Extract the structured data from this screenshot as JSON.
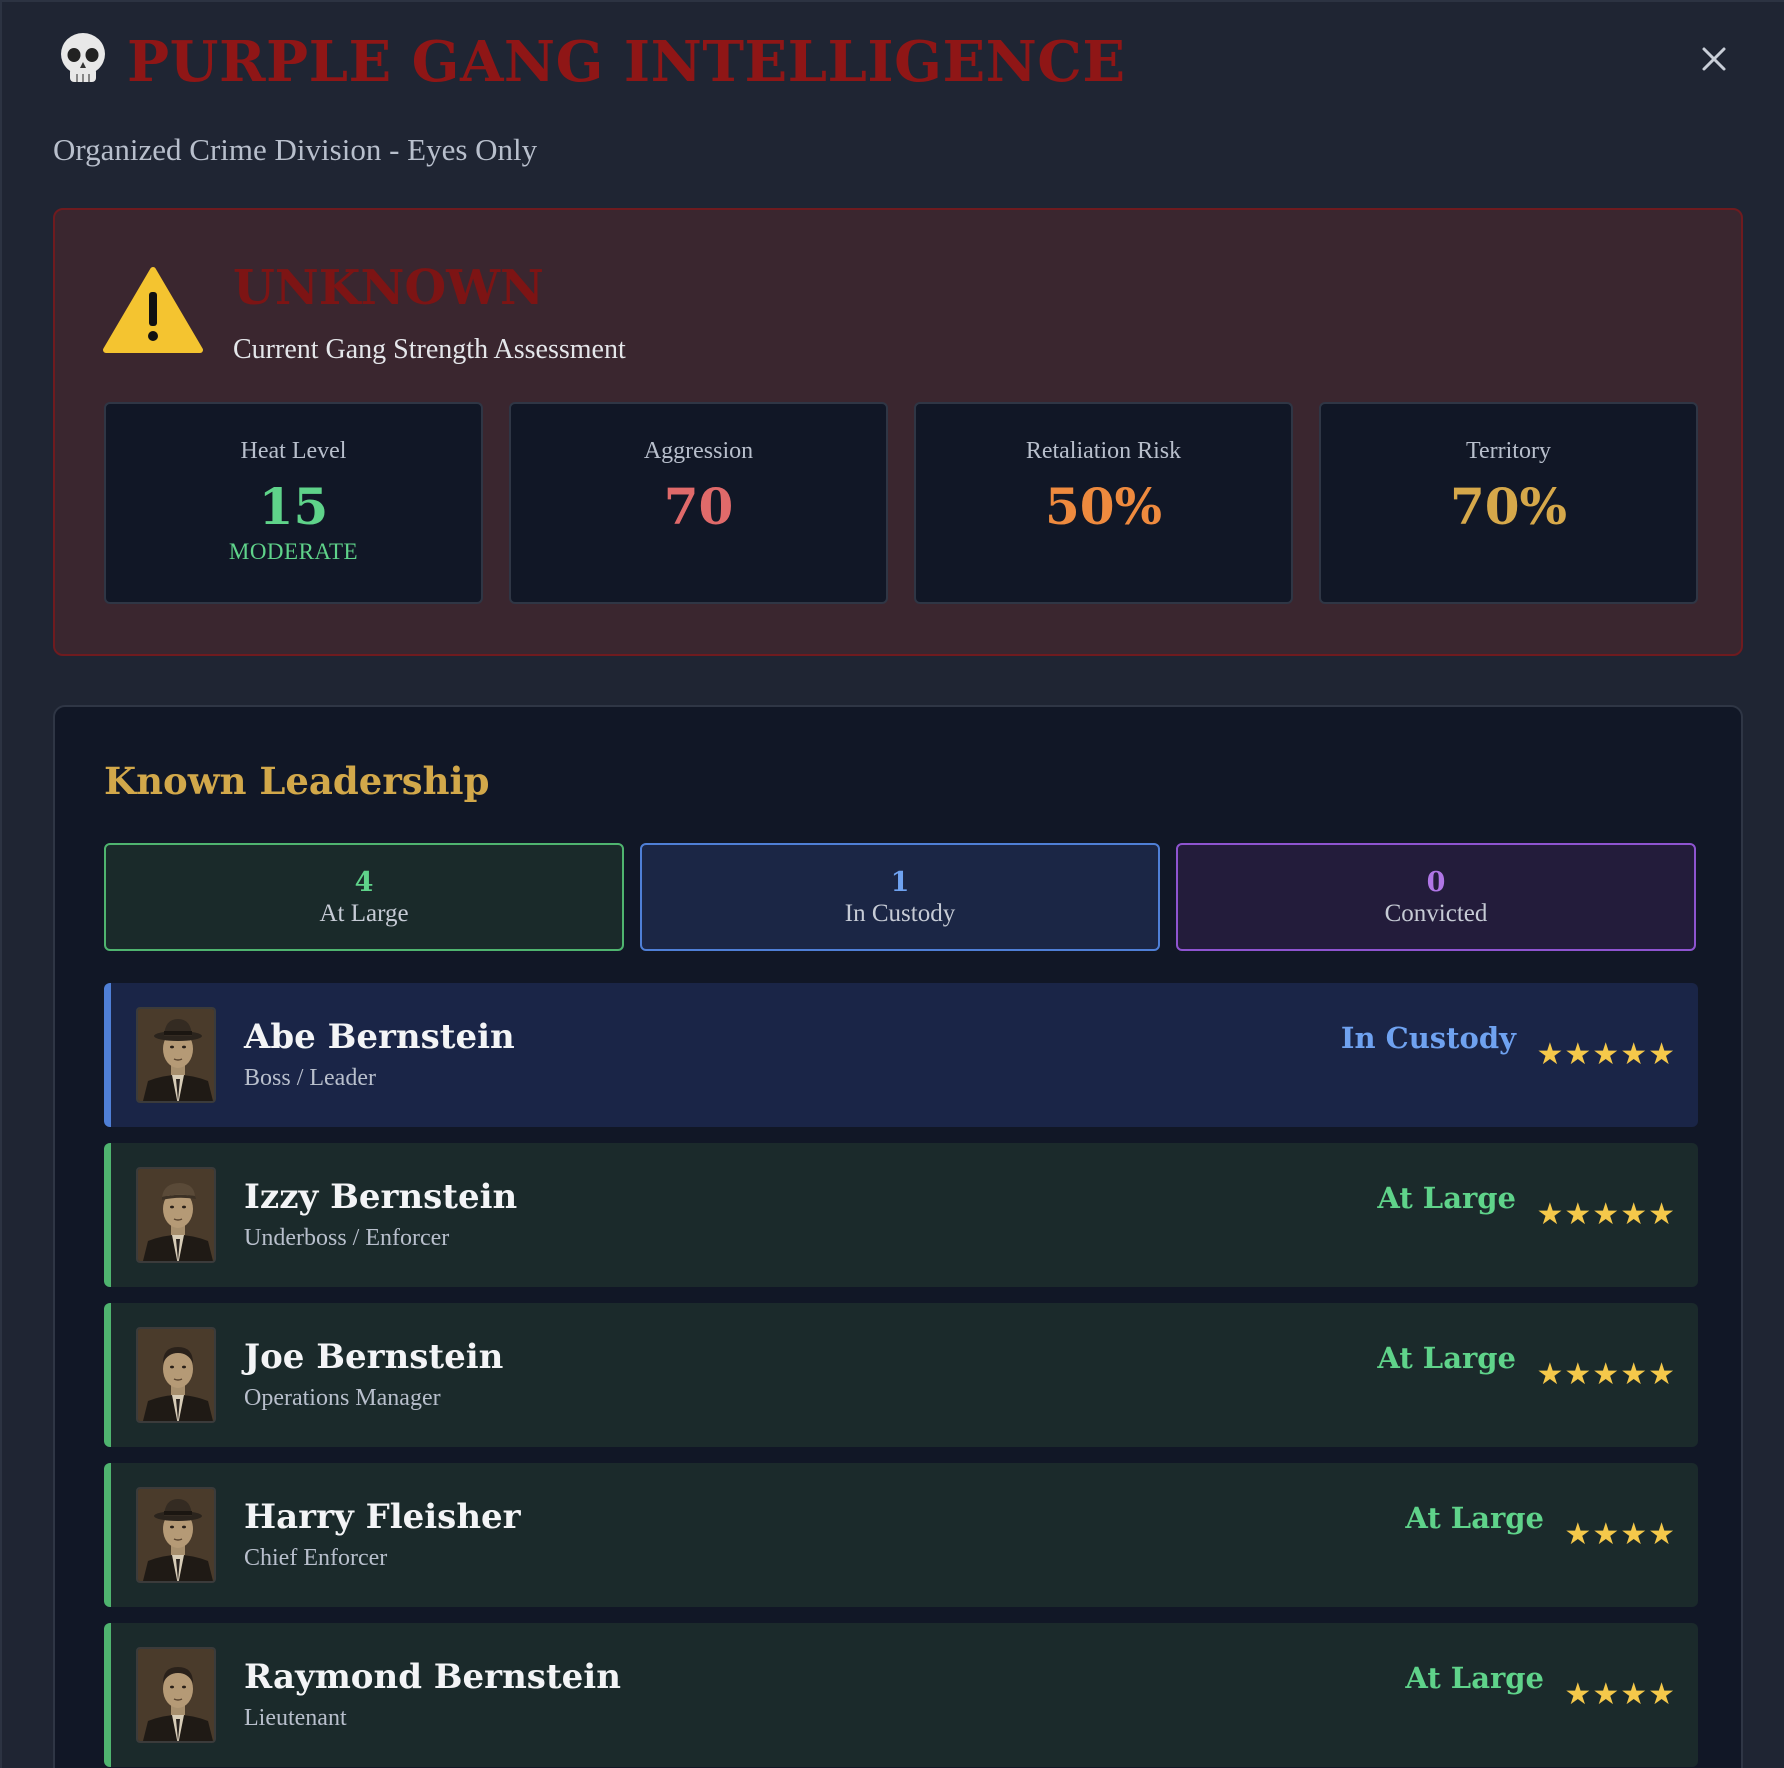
{
  "header": {
    "title": "PURPLE GANG INTELLIGENCE",
    "subtitle": "Organized Crime Division - Eyes Only",
    "close_symbol": "✕"
  },
  "threat": {
    "level": "UNKNOWN",
    "description": "Current Gang Strength Assessment",
    "stats": [
      {
        "label": "Heat Level",
        "value": "15",
        "note": "MODERATE",
        "color": "#5fd38a"
      },
      {
        "label": "Aggression",
        "value": "70",
        "note": "",
        "color": "#e06a6a"
      },
      {
        "label": "Retaliation Risk",
        "value": "50%",
        "note": "",
        "color": "#ee8a3e"
      },
      {
        "label": "Territory",
        "value": "70%",
        "note": "",
        "color": "#d6a84a"
      }
    ]
  },
  "leadership": {
    "title": "Known Leadership",
    "tallies": [
      {
        "count": "4",
        "label": "At Large",
        "color": "#5fd38a",
        "bg": "#1a2a2a",
        "border": "#4fb46f"
      },
      {
        "count": "1",
        "label": "In Custody",
        "color": "#6fa2f0",
        "bg": "#1b2645",
        "border": "#4f7fd6"
      },
      {
        "count": "0",
        "label": "Convicted",
        "color": "#b076e6",
        "bg": "#231c3b",
        "border": "#8e54d0"
      }
    ],
    "members": [
      {
        "name": "Abe Bernstein",
        "role": "Boss / Leader",
        "status": "In Custody",
        "status_color": "#6fa2f0",
        "bg": "#1a2547",
        "accent": "#4f7fd6",
        "stars": "★★★★★",
        "hat": "fedora"
      },
      {
        "name": "Izzy Bernstein",
        "role": "Underboss / Enforcer",
        "status": "At Large",
        "status_color": "#5fd38a",
        "bg": "#1b2a2b",
        "accent": "#4fb46f",
        "stars": "★★★★★",
        "hat": "cap"
      },
      {
        "name": "Joe Bernstein",
        "role": "Operations Manager",
        "status": "At Large",
        "status_color": "#5fd38a",
        "bg": "#1b2a2b",
        "accent": "#4fb46f",
        "stars": "★★★★★",
        "hat": "none"
      },
      {
        "name": "Harry Fleisher",
        "role": "Chief Enforcer",
        "status": "At Large",
        "status_color": "#5fd38a",
        "bg": "#1b2a2b",
        "accent": "#4fb46f",
        "stars": "★★★★",
        "hat": "fedora"
      },
      {
        "name": "Raymond Bernstein",
        "role": "Lieutenant",
        "status": "At Large",
        "status_color": "#5fd38a",
        "bg": "#1b2a2b",
        "accent": "#4fb46f",
        "stars": "★★★★",
        "hat": "none"
      }
    ]
  }
}
